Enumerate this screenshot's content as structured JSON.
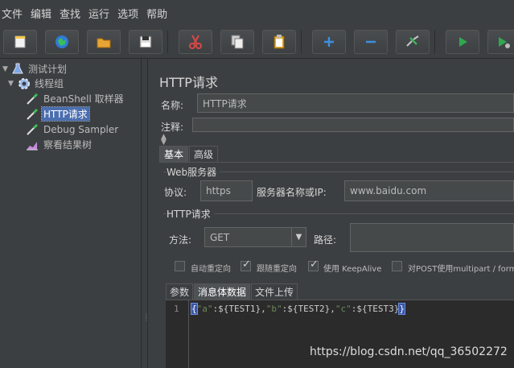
{
  "menu": [
    "文件",
    "编辑",
    "查找",
    "运行",
    "选项",
    "帮助"
  ],
  "toolbar": {
    "buttons": [
      "new-icon",
      "templates-icon",
      "open-icon",
      "save-icon",
      "cut-icon",
      "copy-icon",
      "paste-icon",
      "expand-icon",
      "collapse-icon",
      "toggle-icon",
      "start-icon",
      "start-no-pause-icon"
    ],
    "colors": {
      "play": "#2fa84f",
      "plus": "#3d8fe0",
      "cut": "#d84848"
    }
  },
  "tree": {
    "items": [
      {
        "label": "测试计划",
        "icon": "flask-icon"
      },
      {
        "label": "线程组",
        "icon": "gear-icon"
      },
      {
        "label": "BeanShell 取样器",
        "icon": "pipette-icon"
      },
      {
        "label": "HTTP请求",
        "icon": "pipette-icon"
      },
      {
        "label": "Debug Sampler",
        "icon": "pipette-icon"
      },
      {
        "label": "察看结果树",
        "icon": "chart-icon"
      }
    ]
  },
  "panel": {
    "title": "HTTP请求",
    "name_label": "名称:",
    "name_value": "HTTP请求",
    "comment_label": "注释:",
    "tabs": [
      "基本",
      "高级"
    ],
    "web_server": {
      "group_title": "Web服务器",
      "protocol_label": "协议:",
      "protocol_value": "https",
      "server_label": "服务器名称或IP:",
      "server_value": "www.baidu.com"
    },
    "http_request": {
      "group_title": "HTTP请求",
      "method_label": "方法:",
      "method_value": "GET",
      "path_label": "路径:",
      "checkboxes": [
        {
          "label": "自动重定向",
          "checked": false
        },
        {
          "label": "跟随重定向",
          "checked": true
        },
        {
          "label": "使用 KeepAlive",
          "checked": true
        },
        {
          "label": "对POST使用multipart / form",
          "checked": false
        }
      ]
    },
    "sub_tabs": [
      "参数",
      "消息体数据",
      "文件上传"
    ],
    "editor": {
      "line_number": "1",
      "code_parts": [
        "{",
        "\"a\"",
        ":${TEST1},",
        "\"b\"",
        ":${TEST2},",
        "\"c\"",
        ":${TEST3}",
        "}"
      ]
    }
  },
  "watermark": "https://blog.csdn.net/qq_36502272"
}
